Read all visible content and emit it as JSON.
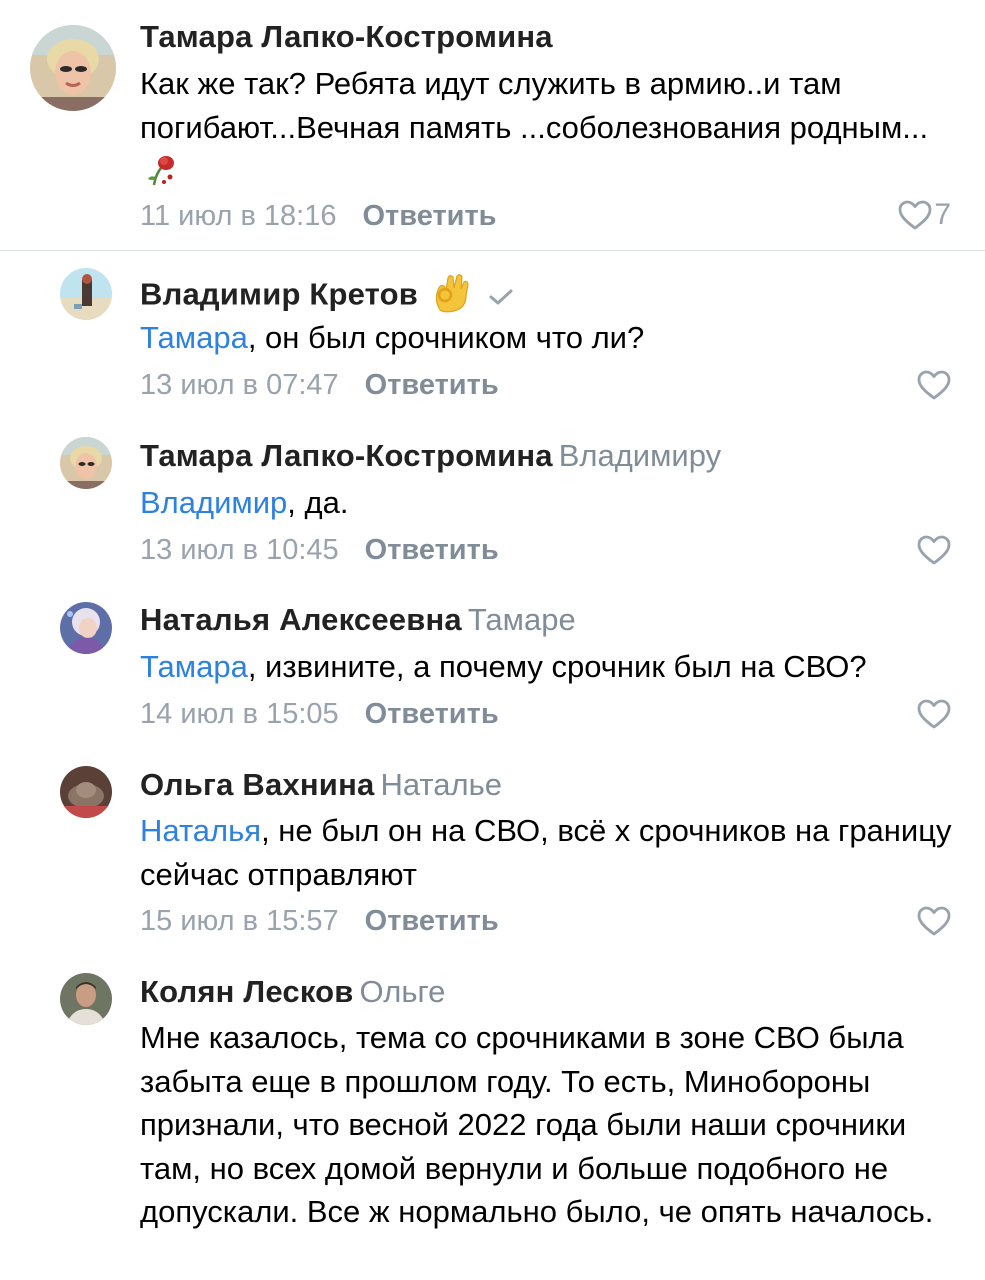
{
  "comments": [
    {
      "author": "Тамара Лапко-Костромина",
      "reply_to": "",
      "mention": "",
      "text": "Как же так? Ребята идут служить в армию..и там погибают...Вечная память ...соболезнования родным...",
      "text_emoji_icon": "wilted-rose-icon",
      "date": "11 июл в 18:16",
      "reply_label": "Ответить",
      "likes": "7"
    },
    {
      "author": "Владимир Кретов",
      "author_emoji_icon": "ok-hand-icon",
      "author_badge_icon": "checkmark-icon",
      "reply_to": "",
      "mention": "Тамара",
      "text": ", он был срочником что ли?",
      "date": "13 июл в 07:47",
      "reply_label": "Ответить",
      "likes": ""
    },
    {
      "author": "Тамара Лапко-Костромина",
      "reply_to": "Владимиру",
      "mention": "Владимир",
      "text": ", да.",
      "date": "13 июл в 10:45",
      "reply_label": "Ответить",
      "likes": ""
    },
    {
      "author": "Наталья Алексеевна",
      "reply_to": "Тамаре",
      "mention": "Тамара",
      "text": ", извините, а почему срочник был на СВО?",
      "date": "14 июл в 15:05",
      "reply_label": "Ответить",
      "likes": ""
    },
    {
      "author": "Ольга Вахнина",
      "reply_to": "Наталье",
      "mention": "Наталья",
      "text": ", не был он на СВО, всё х срочников на границу сейчас отправляют",
      "date": "15 июл в 15:57",
      "reply_label": "Ответить",
      "likes": ""
    },
    {
      "author": "Колян Лесков",
      "reply_to": "Ольге",
      "mention": "",
      "text": "Мне казалось, тема со срочниками в зоне СВО была забыта еще в прошлом году. То есть, Минобороны признали, что весной 2022 года были наши срочники там, но всех домой вернули и больше подобного не допускали. Все ж нормально было, че опять началось."
    }
  ],
  "colors": {
    "link": "#2d81e0",
    "secondary_text": "#99a2ad",
    "reply_button": "#818c99",
    "divider": "#dce1e6"
  }
}
